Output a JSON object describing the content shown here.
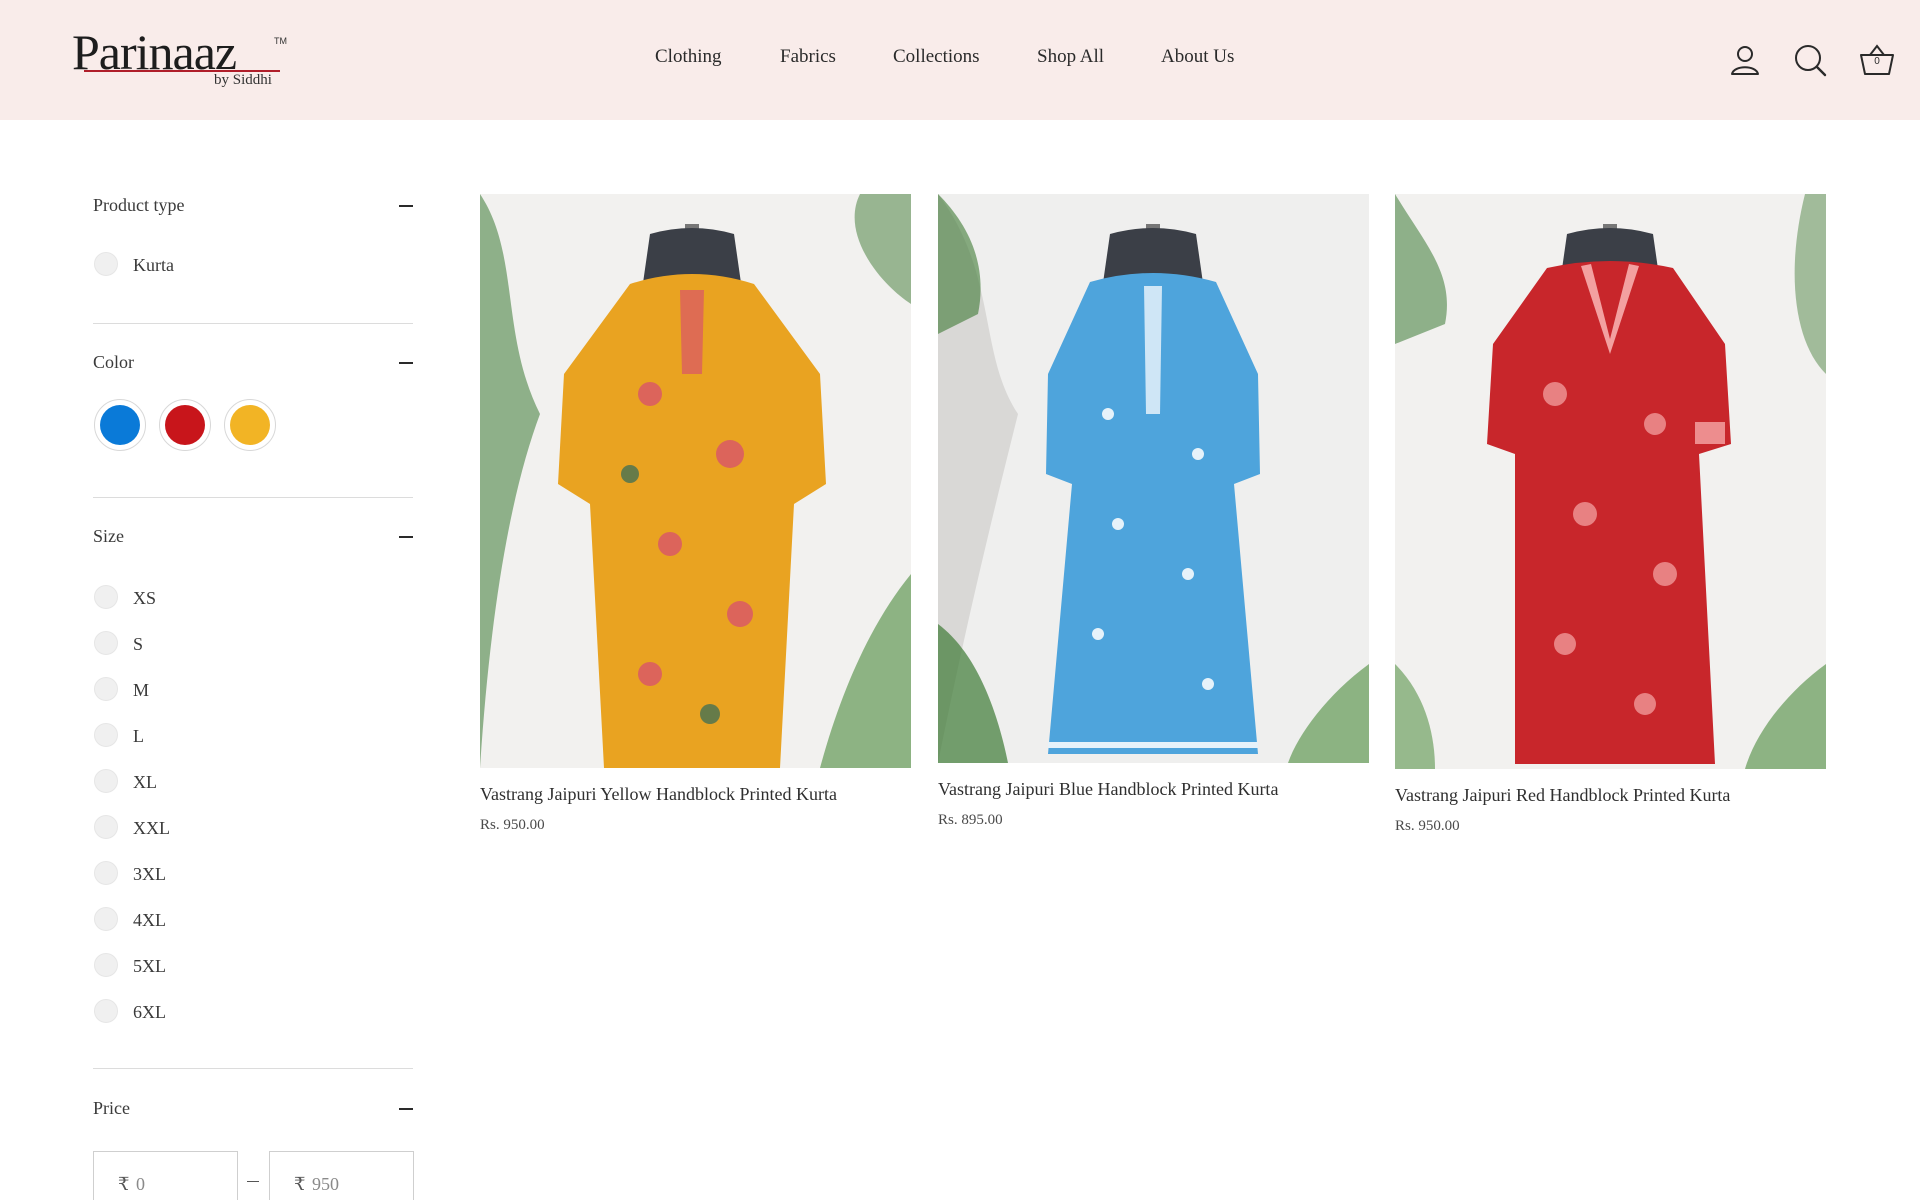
{
  "brand": {
    "name": "Parinaaz",
    "tm": "TM",
    "tagline": "by Siddhi"
  },
  "nav": {
    "items": [
      {
        "label": "Clothing"
      },
      {
        "label": "Fabrics"
      },
      {
        "label": "Collections"
      },
      {
        "label": "Shop All"
      },
      {
        "label": "About Us"
      }
    ]
  },
  "header_icons": {
    "account": "user-icon",
    "search": "search-icon",
    "cart": "basket-icon",
    "cart_count": "0"
  },
  "filters": {
    "product_type": {
      "title": "Product type",
      "options": [
        {
          "label": "Kurta"
        }
      ]
    },
    "color": {
      "title": "Color",
      "swatches": [
        {
          "name": "blue",
          "hex": "#0a7ad8"
        },
        {
          "name": "red",
          "hex": "#c8151b"
        },
        {
          "name": "yellow",
          "hex": "#f2b425"
        }
      ]
    },
    "size": {
      "title": "Size",
      "options": [
        {
          "label": "XS"
        },
        {
          "label": "S"
        },
        {
          "label": "M"
        },
        {
          "label": "L"
        },
        {
          "label": "XL"
        },
        {
          "label": "XXL"
        },
        {
          "label": "3XL"
        },
        {
          "label": "4XL"
        },
        {
          "label": "5XL"
        },
        {
          "label": "6XL"
        }
      ]
    },
    "price": {
      "title": "Price",
      "currency": "₹",
      "min": "0",
      "max": "950"
    }
  },
  "products": [
    {
      "name": "Vastrang Jaipuri Yellow Handblock Printed Kurta",
      "price": "Rs. 950.00",
      "kurta_color": "#e9a321",
      "print_color": "#d8546a"
    },
    {
      "name": "Vastrang Jaipuri Blue Handblock Printed Kurta",
      "price": "Rs. 895.00",
      "kurta_color": "#4ea4dc",
      "print_color": "#e6f2fa"
    },
    {
      "name": "Vastrang Jaipuri Red Handblock Printed Kurta",
      "price": "Rs. 950.00",
      "kurta_color": "#c8262b",
      "print_color": "#f3a0a0"
    }
  ]
}
